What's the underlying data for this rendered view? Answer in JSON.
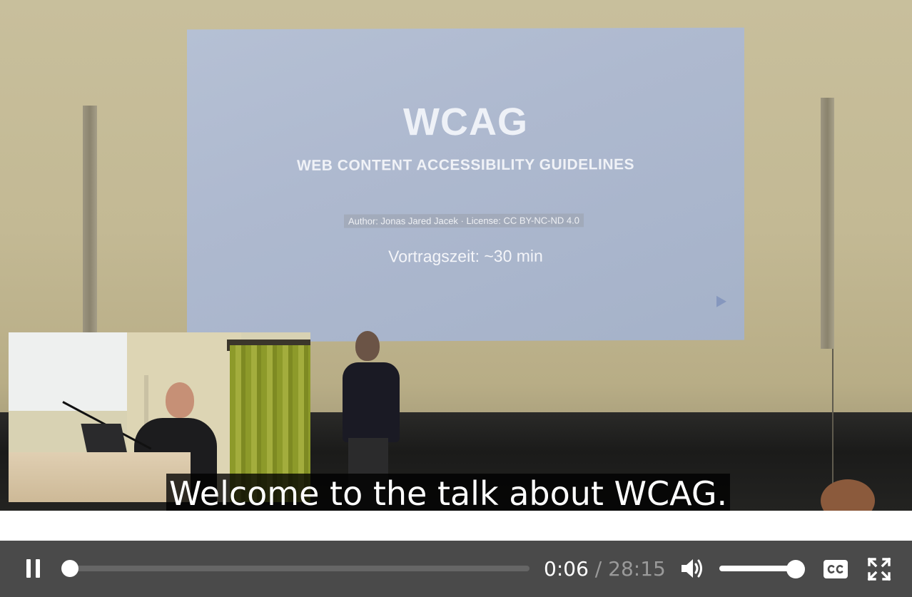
{
  "video": {
    "slide": {
      "title": "WCAG",
      "subtitle": "WEB CONTENT ACCESSIBILITY GUIDELINES",
      "author_line": "Author: Jonas Jared Jacek · License: CC BY-NC-ND 4.0",
      "talk_time": "Vortragszeit: ~30 min"
    },
    "caption": "Welcome to the talk about WCAG."
  },
  "controls": {
    "play_pause_icon": "pause-icon",
    "progress_fraction": 0.0035,
    "current_time": "0:06",
    "separator": "/",
    "duration": "28:15",
    "volume_icon": "volume-high-icon",
    "volume_fraction": 0.9,
    "captions_icon": "closed-captions-icon",
    "fullscreen_icon": "fullscreen-icon",
    "colors": {
      "bar_background": "#4a4a4a",
      "track": "#666666",
      "progress_fill": "#2d8fd5",
      "thumb": "#ffffff"
    }
  }
}
